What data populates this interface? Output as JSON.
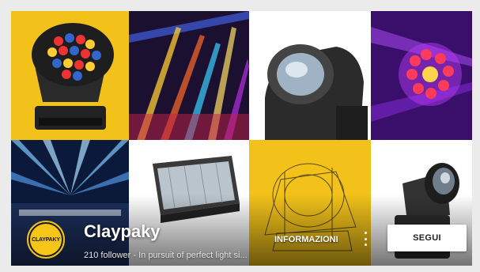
{
  "channel": {
    "name": "Claypaky",
    "meta": "210 follower - In pursuit of perfect light si...",
    "avatar_text": "CLAYPAKY"
  },
  "actions": {
    "info_label": "INFORMAZIONI",
    "follow_label": "SEGUI"
  },
  "tiles": [
    {
      "name": "moving-head-wash-yellow-photo",
      "background": "#f2c21a"
    },
    {
      "name": "stage-beams-photo",
      "background": "#1b1030"
    },
    {
      "name": "moving-head-closeup-photo",
      "background": "#ffffff"
    },
    {
      "name": "flower-led-effect-photo",
      "background": "#3a0f6b"
    },
    {
      "name": "arena-lightshow-photo",
      "background": "#0b1a3a"
    },
    {
      "name": "strobe-fixture-photo",
      "background": "#ffffff"
    },
    {
      "name": "fixture-wireframe-photo",
      "background": "#f2c21a"
    },
    {
      "name": "spot-fixture-photo",
      "background": "#ffffff"
    }
  ],
  "colors": {
    "brand_yellow": "#f2c21a",
    "page_bg": "#ebebeb"
  }
}
